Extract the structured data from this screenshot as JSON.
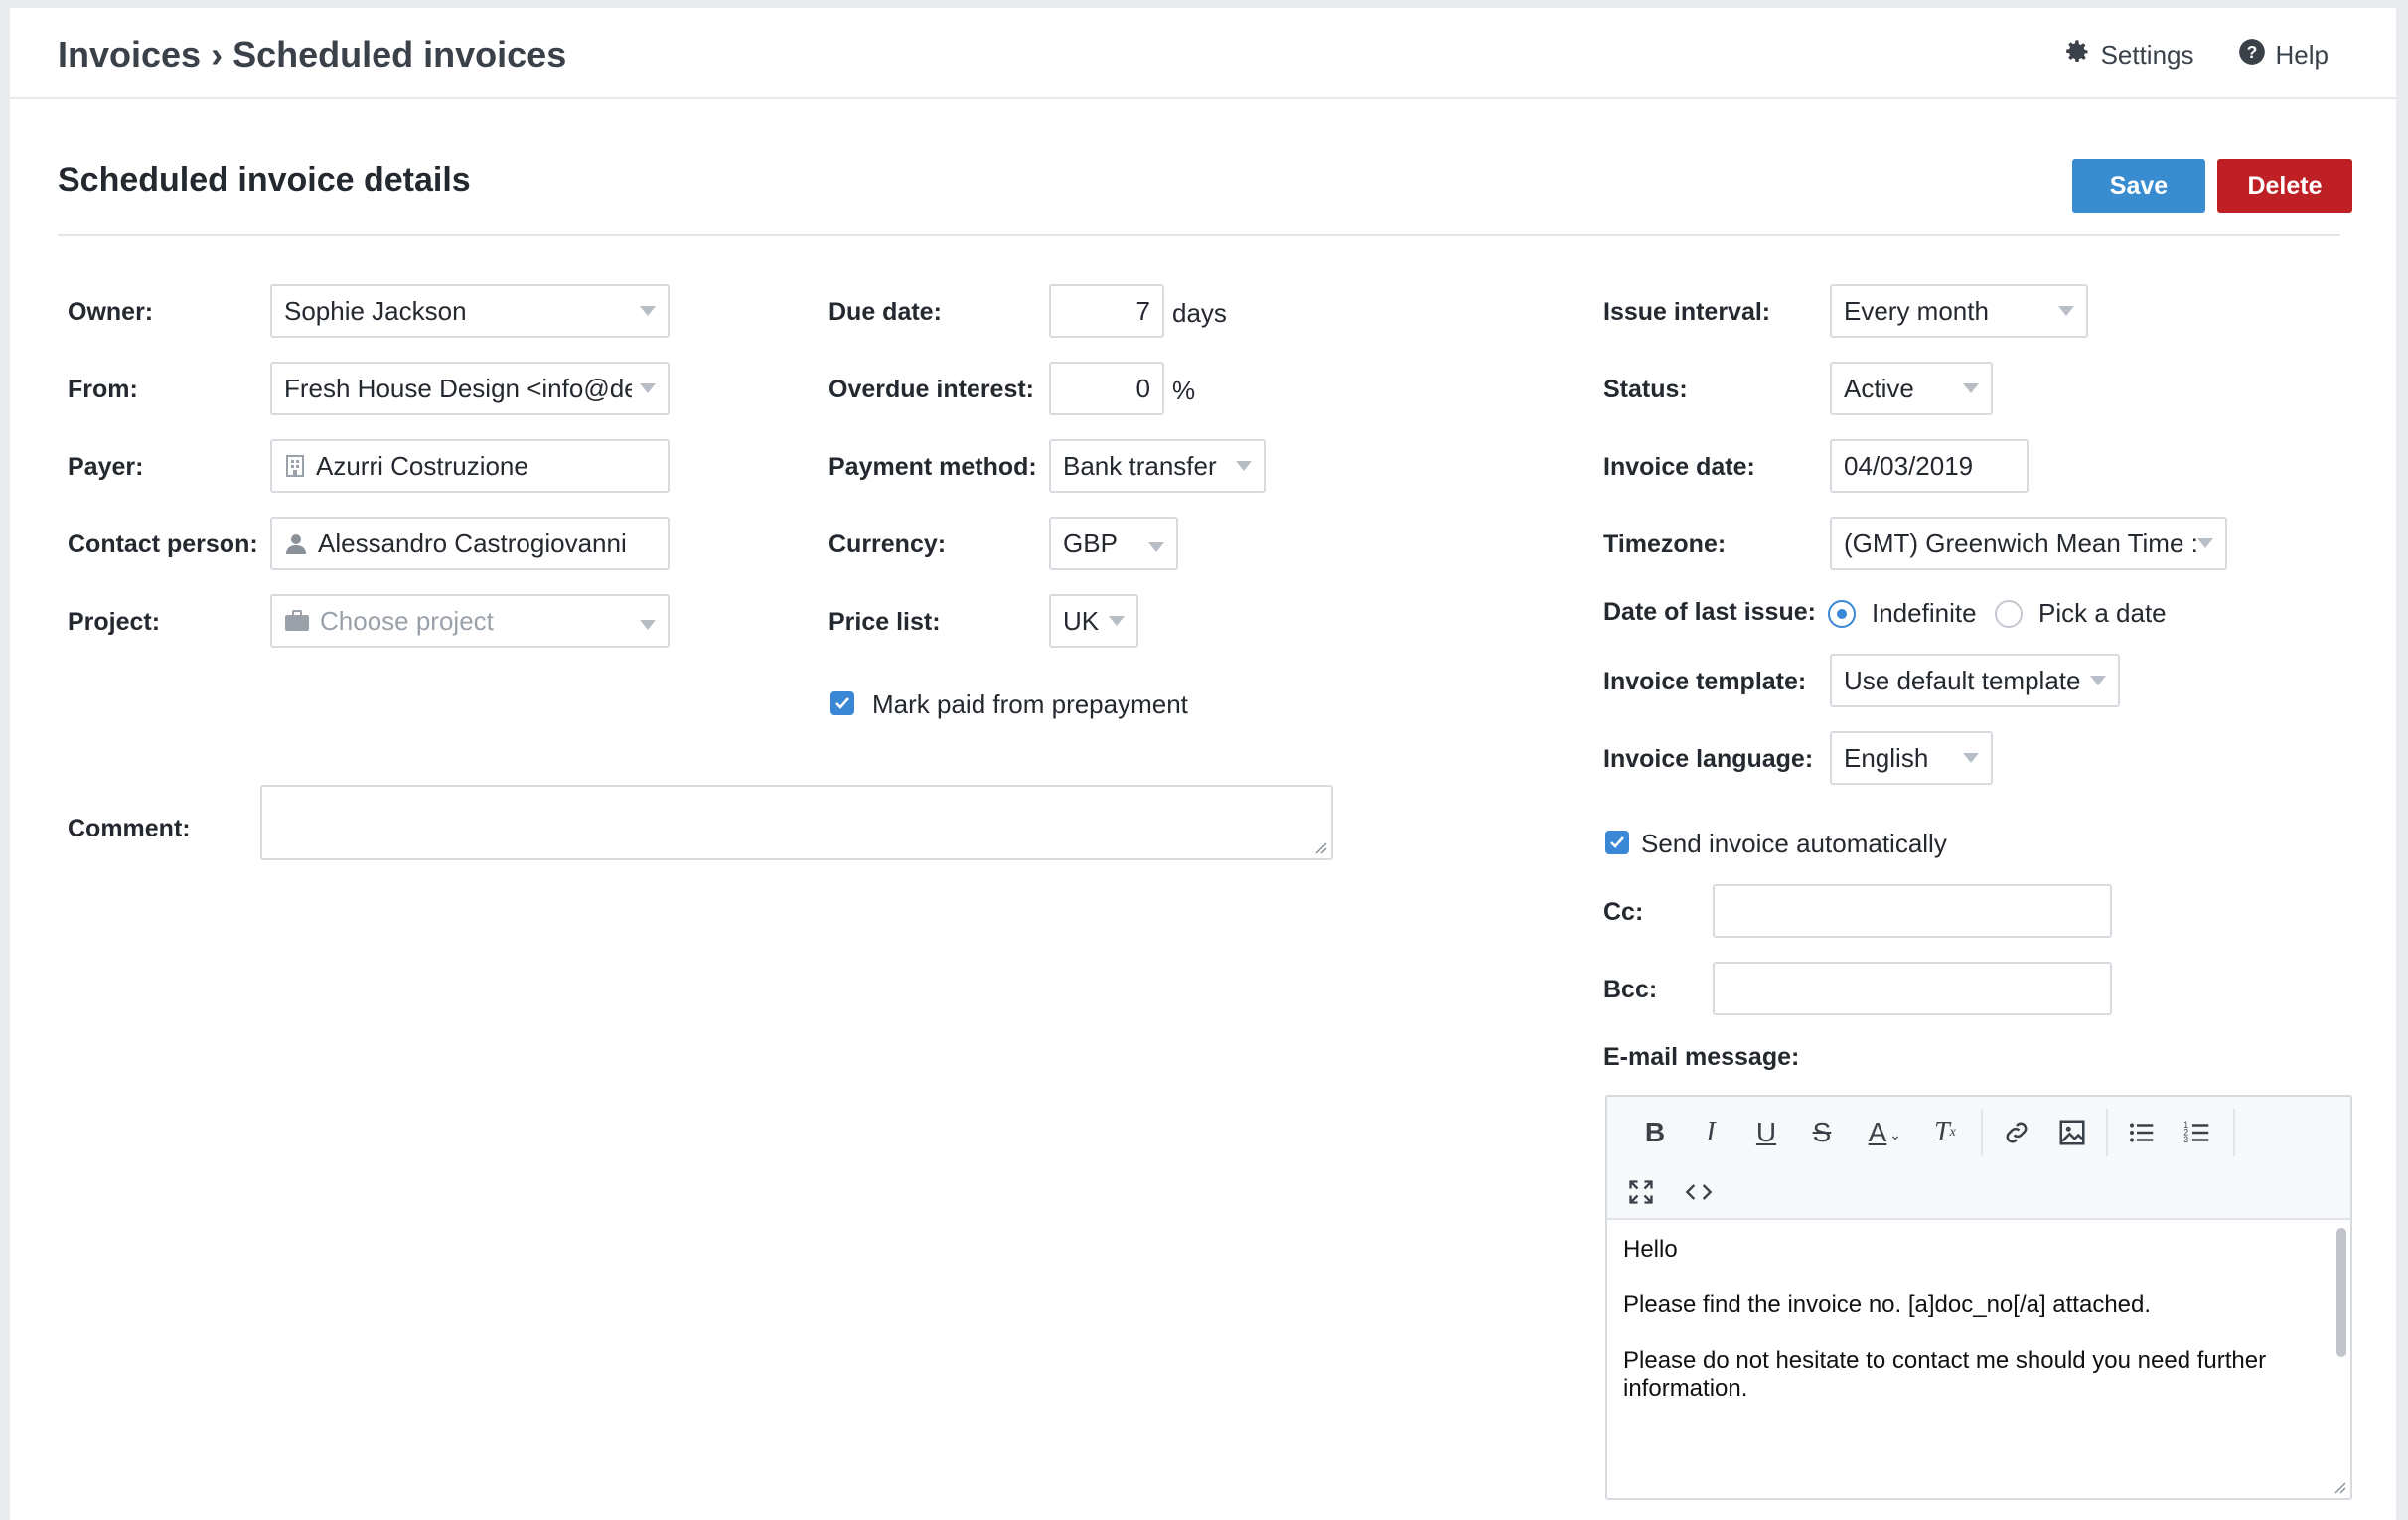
{
  "breadcrumb": {
    "parent": "Invoices",
    "separator": "›",
    "current": "Scheduled invoices"
  },
  "top_actions": {
    "settings": "Settings",
    "help": "Help"
  },
  "section": {
    "title": "Scheduled invoice details",
    "save_label": "Save",
    "delete_label": "Delete"
  },
  "left": {
    "owner_label": "Owner:",
    "owner_value": "Sophie Jackson",
    "from_label": "From:",
    "from_value": "Fresh House Design <info@des",
    "payer_label": "Payer:",
    "payer_value": "Azurri Costruzione",
    "contact_label": "Contact person:",
    "contact_value": "Alessandro Castrogiovanni",
    "project_label": "Project:",
    "project_placeholder": "Choose project",
    "comment_label": "Comment:"
  },
  "middle": {
    "due_label": "Due date:",
    "due_value": "7",
    "due_suffix": "days",
    "interest_label": "Overdue interest:",
    "interest_value": "0",
    "interest_suffix": "%",
    "payment_label": "Payment method:",
    "payment_value": "Bank transfer",
    "currency_label": "Currency:",
    "currency_value": "GBP",
    "pricelist_label": "Price list:",
    "pricelist_value": "UK",
    "prepayment_label": "Mark paid from prepayment",
    "prepayment_checked": true
  },
  "right": {
    "interval_label": "Issue interval:",
    "interval_value": "Every month",
    "status_label": "Status:",
    "status_value": "Active",
    "invoice_date_label": "Invoice date:",
    "invoice_date_value": "04/03/2019",
    "timezone_label": "Timezone:",
    "timezone_value": "(GMT) Greenwich Mean Time :",
    "last_issue_label": "Date of last issue:",
    "last_issue_option1": "Indefinite",
    "last_issue_option2": "Pick a date",
    "last_issue_selected": "Indefinite",
    "template_label": "Invoice template:",
    "template_value": "Use default template",
    "language_label": "Invoice language:",
    "language_value": "English",
    "send_auto_label": "Send invoice automatically",
    "send_auto_checked": true,
    "cc_label": "Cc:",
    "bcc_label": "Bcc:",
    "email_label": "E-mail message:"
  },
  "email_message": {
    "line1": "Hello",
    "line2": "Please find the invoice no. [a]doc_no[/a] attached.",
    "line3": "Please do not hesitate to contact me should you need further information."
  },
  "colors": {
    "save": "#3a8cd0",
    "delete": "#bf2026",
    "accent": "#3a87d6"
  }
}
